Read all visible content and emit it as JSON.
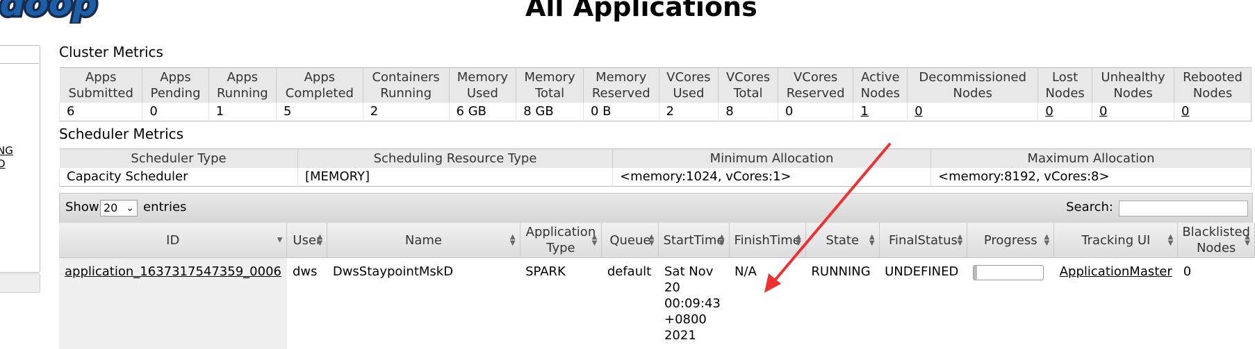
{
  "logo": {
    "text": "adoop"
  },
  "page_title": "All Applications",
  "sidebar": {
    "links": [
      "NG",
      "D"
    ]
  },
  "cluster_metrics": {
    "title": "Cluster Metrics",
    "headers": [
      [
        "Apps",
        "Submitted"
      ],
      [
        "Apps",
        "Pending"
      ],
      [
        "Apps",
        "Running"
      ],
      [
        "Apps",
        "Completed"
      ],
      [
        "Containers",
        "Running"
      ],
      [
        "Memory",
        "Used"
      ],
      [
        "Memory",
        "Total"
      ],
      [
        "Memory",
        "Reserved"
      ],
      [
        "VCores",
        "Used"
      ],
      [
        "VCores",
        "Total"
      ],
      [
        "VCores",
        "Reserved"
      ],
      [
        "Active",
        "Nodes"
      ],
      [
        "Decommissioned",
        "Nodes"
      ],
      [
        "Lost",
        "Nodes"
      ],
      [
        "Unhealthy",
        "Nodes"
      ],
      [
        "Rebooted",
        "Nodes"
      ]
    ],
    "values": [
      "6",
      "0",
      "1",
      "5",
      "2",
      "6 GB",
      "8 GB",
      "0 B",
      "2",
      "8",
      "0",
      "1",
      "0",
      "0",
      "0",
      "0"
    ]
  },
  "scheduler_metrics": {
    "title": "Scheduler Metrics",
    "headers": [
      "Scheduler Type",
      "Scheduling Resource Type",
      "Minimum Allocation",
      "Maximum Allocation"
    ],
    "values": [
      "Capacity Scheduler",
      "[MEMORY]",
      "<memory:1024, vCores:1>",
      "<memory:8192, vCores:8>"
    ]
  },
  "apps_table": {
    "show_label": "Show",
    "entries_value": "20",
    "entries_label": "entries",
    "search_label": "Search:",
    "search_value": "",
    "headers": [
      [
        "ID"
      ],
      [
        "User"
      ],
      [
        "Name"
      ],
      [
        "Application",
        "Type"
      ],
      [
        "Queue"
      ],
      [
        "StartTime"
      ],
      [
        "FinishTime"
      ],
      [
        "State"
      ],
      [
        "FinalStatus"
      ],
      [
        "Progress"
      ],
      [
        "Tracking UI"
      ],
      [
        "Blacklisted",
        "Nodes"
      ]
    ],
    "rows": [
      {
        "id": "application_1637317547359_0006",
        "user": "dws",
        "name": "DwsStaypointMskD",
        "type": "SPARK",
        "queue": "default",
        "start_lines": [
          "Sat Nov",
          "20",
          "00:09:43",
          "+0800",
          "2021"
        ],
        "finish": "N/A",
        "state": "RUNNING",
        "final_status": "UNDEFINED",
        "progress_percent": 5,
        "tracking_ui": "ApplicationMaster",
        "blacklisted": "0"
      }
    ]
  },
  "colors": {
    "annotation_arrow": "#f03030",
    "logo_fill": "#1a5fa8"
  }
}
